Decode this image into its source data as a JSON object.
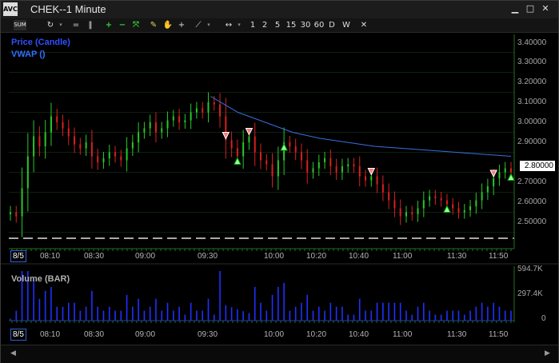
{
  "window": {
    "title": "CHEK--1 Minute",
    "logo_text": "AVC"
  },
  "window_buttons": [
    {
      "name": "minimize-icon",
      "glyph": "▁"
    },
    {
      "name": "maximize-icon",
      "glyph": "□"
    },
    {
      "name": "close-icon",
      "glyph": "✕"
    }
  ],
  "toolbar": {
    "sum_label": "SUM",
    "intervals": [
      "1",
      "2",
      "5",
      "15",
      "30",
      "60",
      "D",
      "W"
    ],
    "close_glyph": "✕"
  },
  "price_panel": {
    "legend": [
      {
        "label": "Price (Candle)",
        "color": "#2f4fff"
      },
      {
        "label": "VWAP ()",
        "color": "#2f6fff"
      }
    ],
    "last_price_label": "2.80000",
    "y_ticks": [
      "3.40000",
      "3.30000",
      "3.20000",
      "3.10000",
      "3.00000",
      "2.90000",
      "2.80000",
      "2.70000",
      "2.60000",
      "2.50000"
    ]
  },
  "volume_panel": {
    "legend": "Volume (BAR)",
    "y_ticks": [
      "594.7K",
      "297.4K",
      "0"
    ]
  },
  "time_axis": {
    "date_label": "8/5",
    "labels": [
      "08:10",
      "08:30",
      "09:00",
      "09:30",
      "10:00",
      "10:20",
      "10:40",
      "11:00",
      "11:30",
      "11:50"
    ]
  },
  "colors": {
    "up": "#28c828",
    "down": "#d82020",
    "vwap": "#3a6fe0",
    "volume": "#2030ff",
    "axis": "#1a5a1a"
  },
  "chart_data": {
    "type": "candlestick",
    "symbol": "CHEK",
    "interval": "1 Minute",
    "ylim": [
      2.45,
      3.45
    ],
    "close": [
      2.6,
      2.58,
      2.72,
      2.88,
      2.98,
      2.93,
      3.0,
      3.08,
      3.05,
      3.02,
      2.98,
      2.94,
      2.92,
      2.95,
      2.88,
      2.85,
      2.87,
      2.9,
      2.88,
      2.86,
      2.92,
      2.95,
      3.0,
      3.02,
      3.05,
      3.0,
      3.02,
      3.06,
      3.08,
      3.05,
      3.06,
      3.1,
      3.12,
      3.1,
      3.15,
      3.14,
      3.08,
      2.96,
      2.92,
      2.88,
      2.95,
      2.98,
      2.9,
      2.86,
      2.84,
      2.78,
      2.86,
      2.95,
      2.93,
      2.9,
      2.86,
      2.8,
      2.82,
      2.85,
      2.87,
      2.83,
      2.8,
      2.83,
      2.84,
      2.83,
      2.78,
      2.76,
      2.78,
      2.74,
      2.7,
      2.66,
      2.62,
      2.58,
      2.6,
      2.59,
      2.62,
      2.66,
      2.68,
      2.67,
      2.66,
      2.64,
      2.62,
      2.6,
      2.61,
      2.63,
      2.66,
      2.7,
      2.73,
      2.77,
      2.8,
      2.82,
      2.8
    ],
    "vwap": [
      3.18,
      3.1,
      3.05,
      3.0,
      2.97,
      2.95,
      2.93,
      2.92,
      2.91,
      2.9,
      2.89,
      2.88
    ],
    "volume_max": "594.7K"
  }
}
